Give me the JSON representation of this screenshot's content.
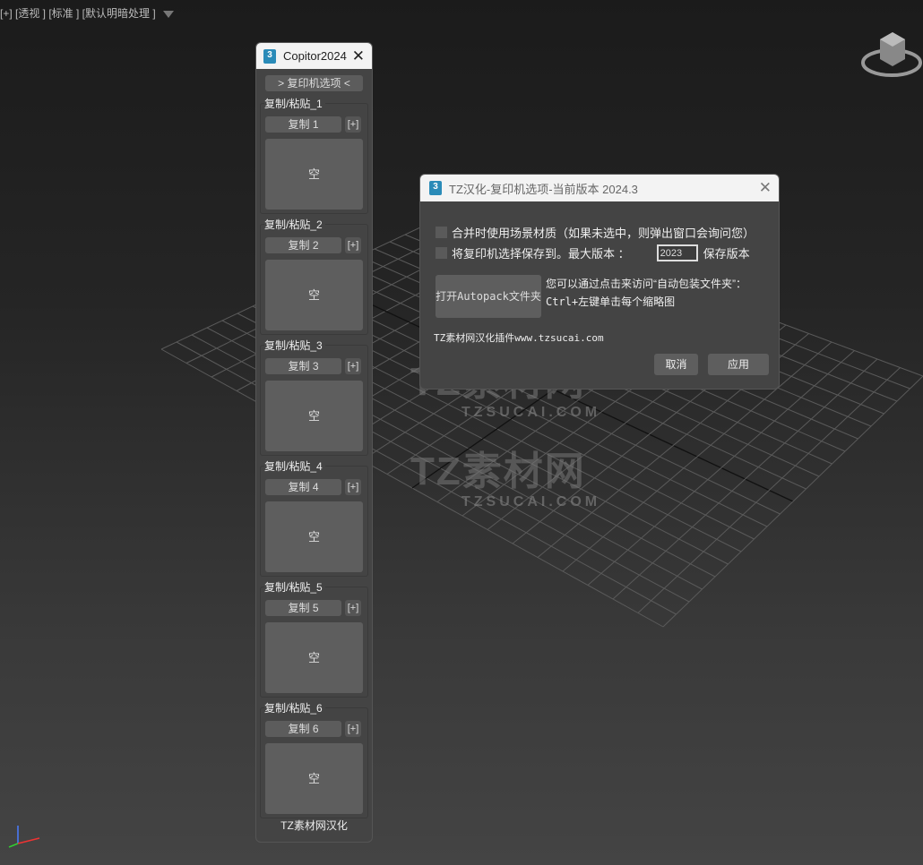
{
  "viewport": {
    "label": "[+] [透视 ] [标准 ] [默认明暗处理 ]"
  },
  "watermark": {
    "main": "TZ素材网",
    "sub": "TZSUCAI.COM"
  },
  "panel": {
    "title": "Copitor2024",
    "options_label": "> 复印机选项 <",
    "groups": [
      {
        "label": "复制/粘贴_1",
        "copy": "复制 1",
        "plus": "[+]",
        "thumb": "空"
      },
      {
        "label": "复制/粘贴_2",
        "copy": "复制 2",
        "plus": "[+]",
        "thumb": "空"
      },
      {
        "label": "复制/粘贴_3",
        "copy": "复制 3",
        "plus": "[+]",
        "thumb": "空"
      },
      {
        "label": "复制/粘贴_4",
        "copy": "复制 4",
        "plus": "[+]",
        "thumb": "空"
      },
      {
        "label": "复制/粘贴_5",
        "copy": "复制 5",
        "plus": "[+]",
        "thumb": "空"
      },
      {
        "label": "复制/粘贴_6",
        "copy": "复制 6",
        "plus": "[+]",
        "thumb": "空"
      }
    ],
    "footer": "TZ素材网汉化"
  },
  "dialog": {
    "title": "TZ汉化-复印机选项-当前版本 2024.3",
    "opt1": "合并时使用场景材质（如果未选中，则弹出窗口会询问您）",
    "opt2": "将复印机选择保存到。最大版本 ：",
    "version": "2023",
    "opt2_suffix": "保存版本",
    "autopack": "打开Autopack文件夹",
    "hint1": "您可以通过点击来访问“自动包装文件夹”：",
    "hint2": "Ctrl+左键单击每个缩略图",
    "credit": "TZ素材网汉化插件www.tzsucai.com",
    "cancel": "取消",
    "apply": "应用"
  }
}
